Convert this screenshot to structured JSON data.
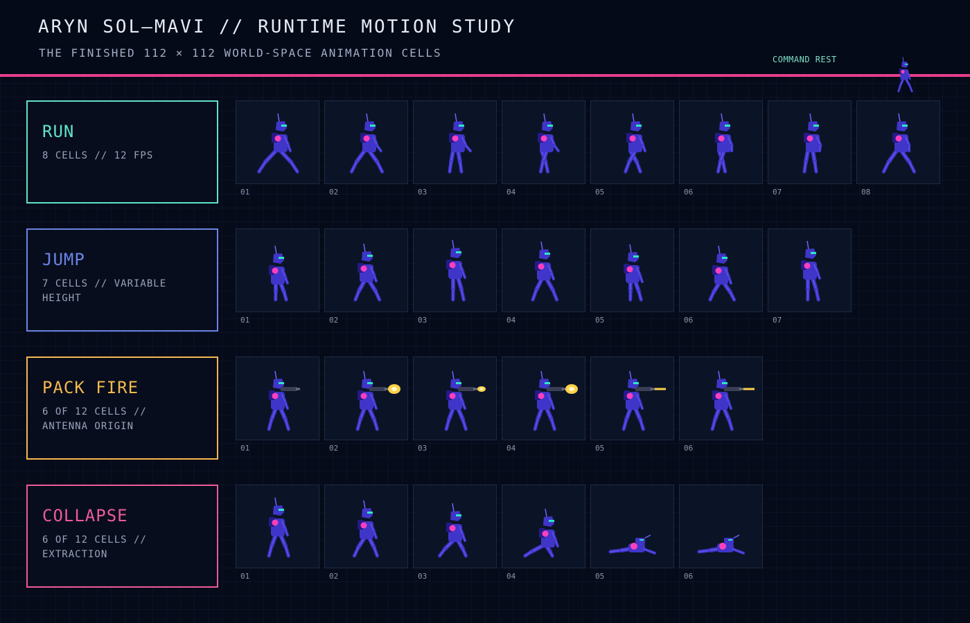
{
  "header": {
    "title": "ARYN SOL—MAVI // RUNTIME MOTION STUDY",
    "subtitle": "THE FINISHED 112 × 112 WORLD-SPACE ANIMATION CELLS",
    "rest_label": "COMMAND REST",
    "rest_figure_icon": "robot-rest-sprite"
  },
  "colors": {
    "background": "#060b1a",
    "accent_line": "#e83e8c",
    "cell_background": "#0b1426",
    "cell_border": "#1d2a46",
    "robot_body": "#3f35c9",
    "robot_visor": "#2ee6c8",
    "robot_core": "#ff3fbf",
    "muzzle_flash": "#ffd24a"
  },
  "animations": [
    {
      "name": "RUN",
      "desc": "8 CELLS // 12 FPS",
      "color": "#5fe3cc",
      "pose": "run",
      "frames": [
        "01",
        "02",
        "03",
        "04",
        "05",
        "06",
        "07",
        "08"
      ]
    },
    {
      "name": "JUMP",
      "desc": "7 CELLS // VARIABLE HEIGHT",
      "color": "#6b84e6",
      "pose": "jump",
      "frames": [
        "01",
        "02",
        "03",
        "04",
        "05",
        "06",
        "07"
      ]
    },
    {
      "name": "PACK FIRE",
      "desc": "6 OF 12 CELLS // ANTENNA ORIGIN",
      "color": "#f5b84f",
      "pose": "fire",
      "frames": [
        "01",
        "02",
        "03",
        "04",
        "05",
        "06"
      ]
    },
    {
      "name": "COLLAPSE",
      "desc": "6 OF 12 CELLS // EXTRACTION",
      "color": "#ee5a9c",
      "pose": "collapse",
      "frames": [
        "01",
        "02",
        "03",
        "04",
        "05",
        "06"
      ]
    }
  ]
}
